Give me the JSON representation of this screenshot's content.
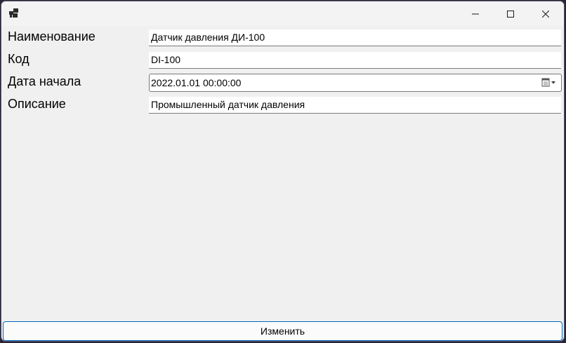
{
  "window": {
    "icon": "app-windows-icon",
    "controls": {
      "minimize_icon": "minimize-icon",
      "maximize_icon": "maximize-icon",
      "close_icon": "close-icon"
    }
  },
  "form": {
    "name": {
      "label": "Наименование",
      "value": "Датчик давления ДИ-100"
    },
    "code": {
      "label": "Код",
      "value": "DI-100"
    },
    "start_date": {
      "label": "Дата начала",
      "value": "2022.01.01 00:00:00",
      "picker_icon": "calendar-dropdown-icon"
    },
    "description": {
      "label": "Описание",
      "value": "Промышленный датчик давления"
    }
  },
  "actions": {
    "submit_label": "Изменить"
  },
  "colors": {
    "window_bg": "#f0f0f0",
    "field_bg": "#ffffff",
    "button_border": "#0067c0"
  }
}
